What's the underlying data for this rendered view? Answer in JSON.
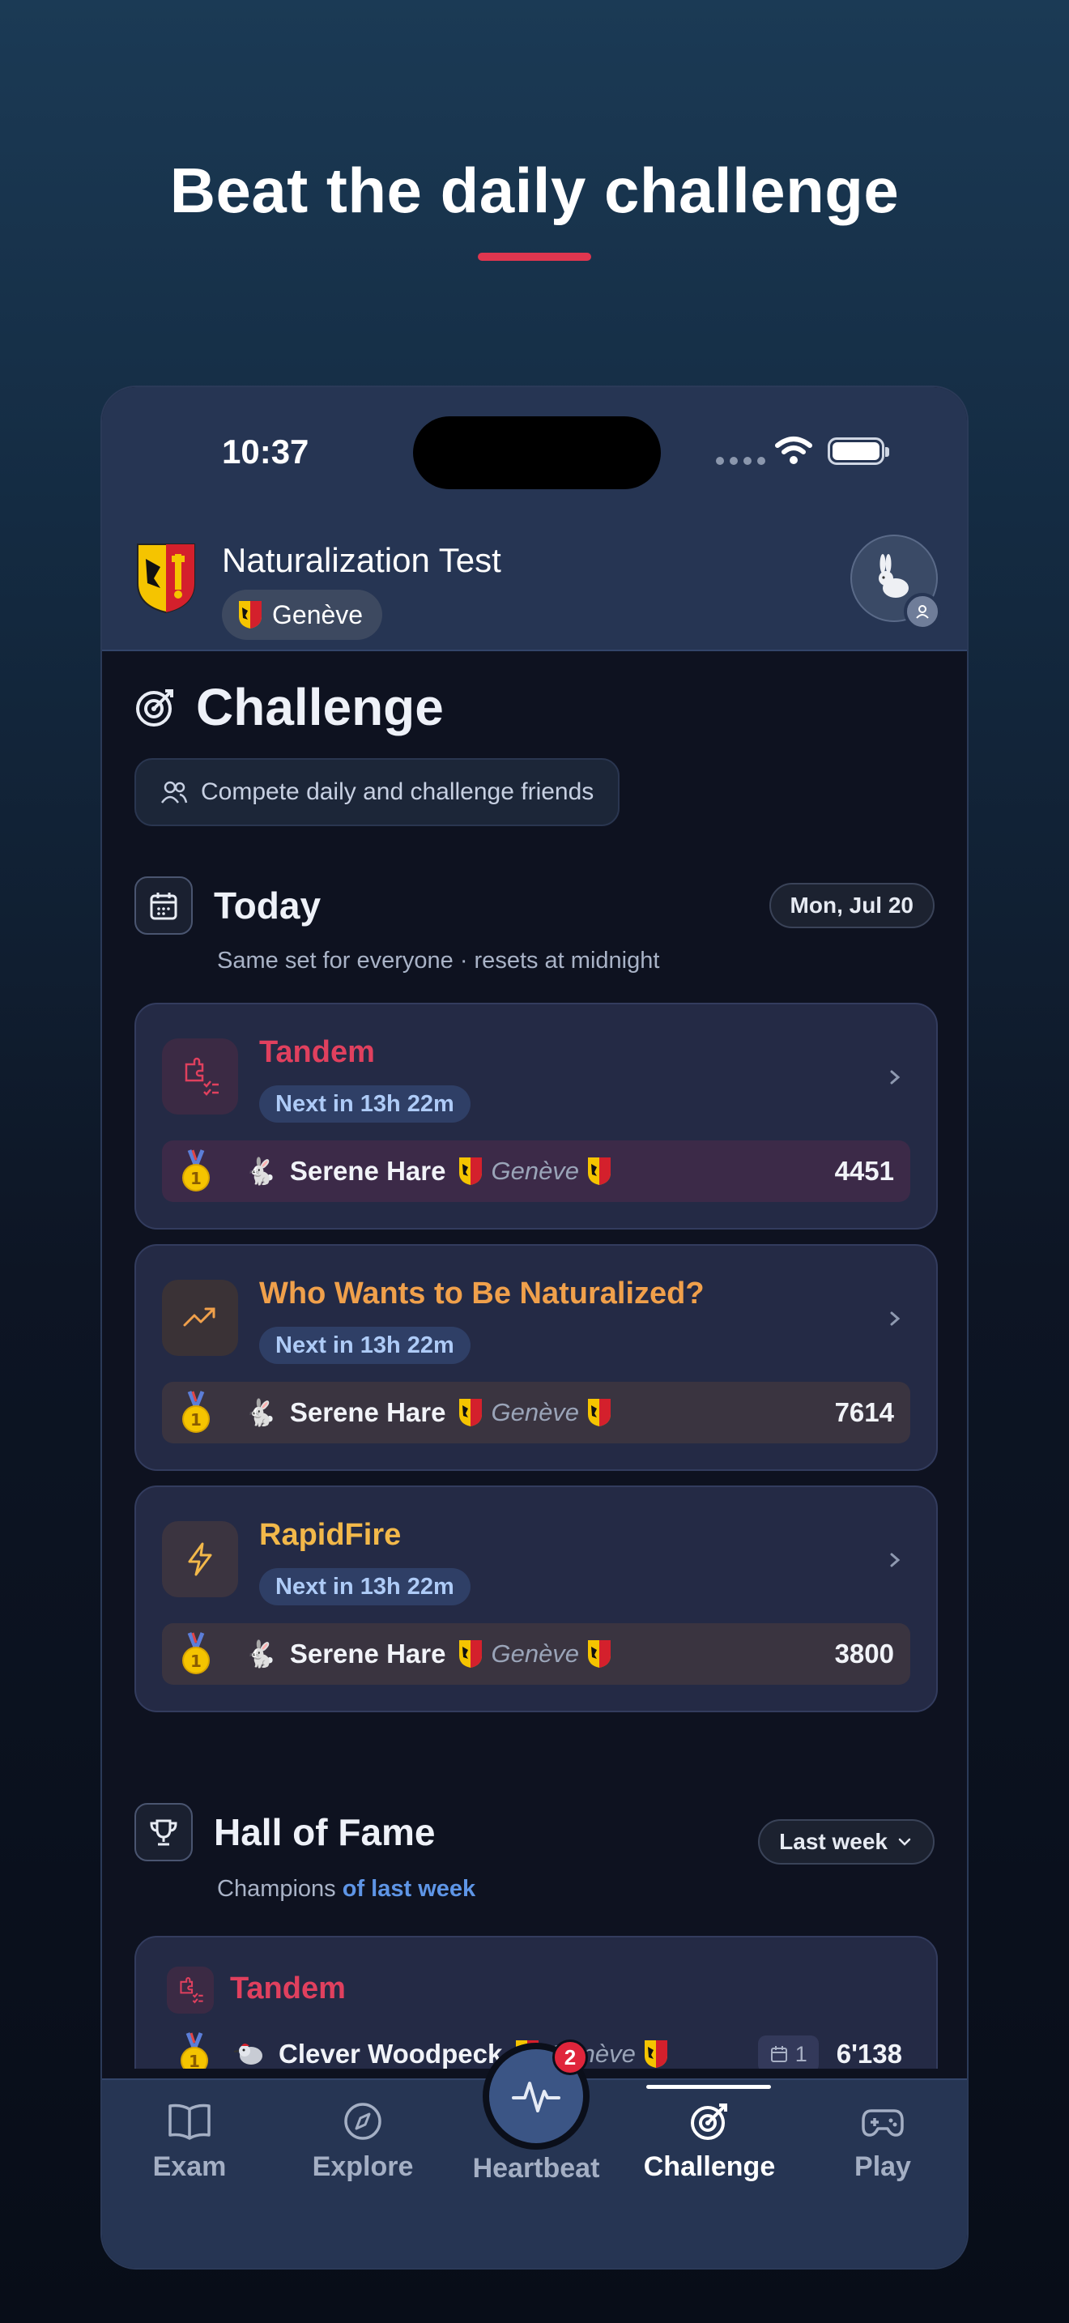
{
  "headline": "Beat the daily challenge",
  "status_bar": {
    "time": "10:37"
  },
  "header": {
    "app_title": "Naturalization Test",
    "canton": "Genève"
  },
  "challenge": {
    "title": "Challenge",
    "tagline": "Compete daily and challenge friends"
  },
  "today": {
    "title": "Today",
    "date": "Mon, Jul 20",
    "subtitle": "Same set for everyone · resets at midnight",
    "games": [
      {
        "name": "Tandem",
        "color": "#e0405e",
        "next": "Next in 13h 22m",
        "player": "Serene Hare",
        "canton": "Genève",
        "score": "4451",
        "icon": "puzzle-checklist-icon"
      },
      {
        "name": "Who Wants to Be Naturalized?",
        "color": "#f0a04b",
        "next": "Next in 13h 22m",
        "player": "Serene Hare",
        "canton": "Genève",
        "score": "7614",
        "icon": "trending-up-icon"
      },
      {
        "name": "RapidFire",
        "color": "#f2b84a",
        "next": "Next in 13h 22m",
        "player": "Serene Hare",
        "canton": "Genève",
        "score": "3800",
        "icon": "lightning-icon"
      }
    ]
  },
  "hall_of_fame": {
    "title": "Hall of Fame",
    "subtitle_prefix": "Champions",
    "subtitle_highlight": "of last week",
    "period": "Last week",
    "card": {
      "game": "Tandem",
      "player": "Clever Woodpeck",
      "canton": "Genève",
      "days": "1",
      "score": "6'138"
    }
  },
  "tabbar": {
    "tabs": [
      {
        "label": "Exam",
        "icon": "book-icon"
      },
      {
        "label": "Explore",
        "icon": "compass-icon"
      },
      {
        "label": "Heartbeat",
        "icon": "pulse-icon",
        "badge": "2"
      },
      {
        "label": "Challenge",
        "icon": "target-icon",
        "active": true
      },
      {
        "label": "Play",
        "icon": "gamepad-icon"
      }
    ]
  }
}
